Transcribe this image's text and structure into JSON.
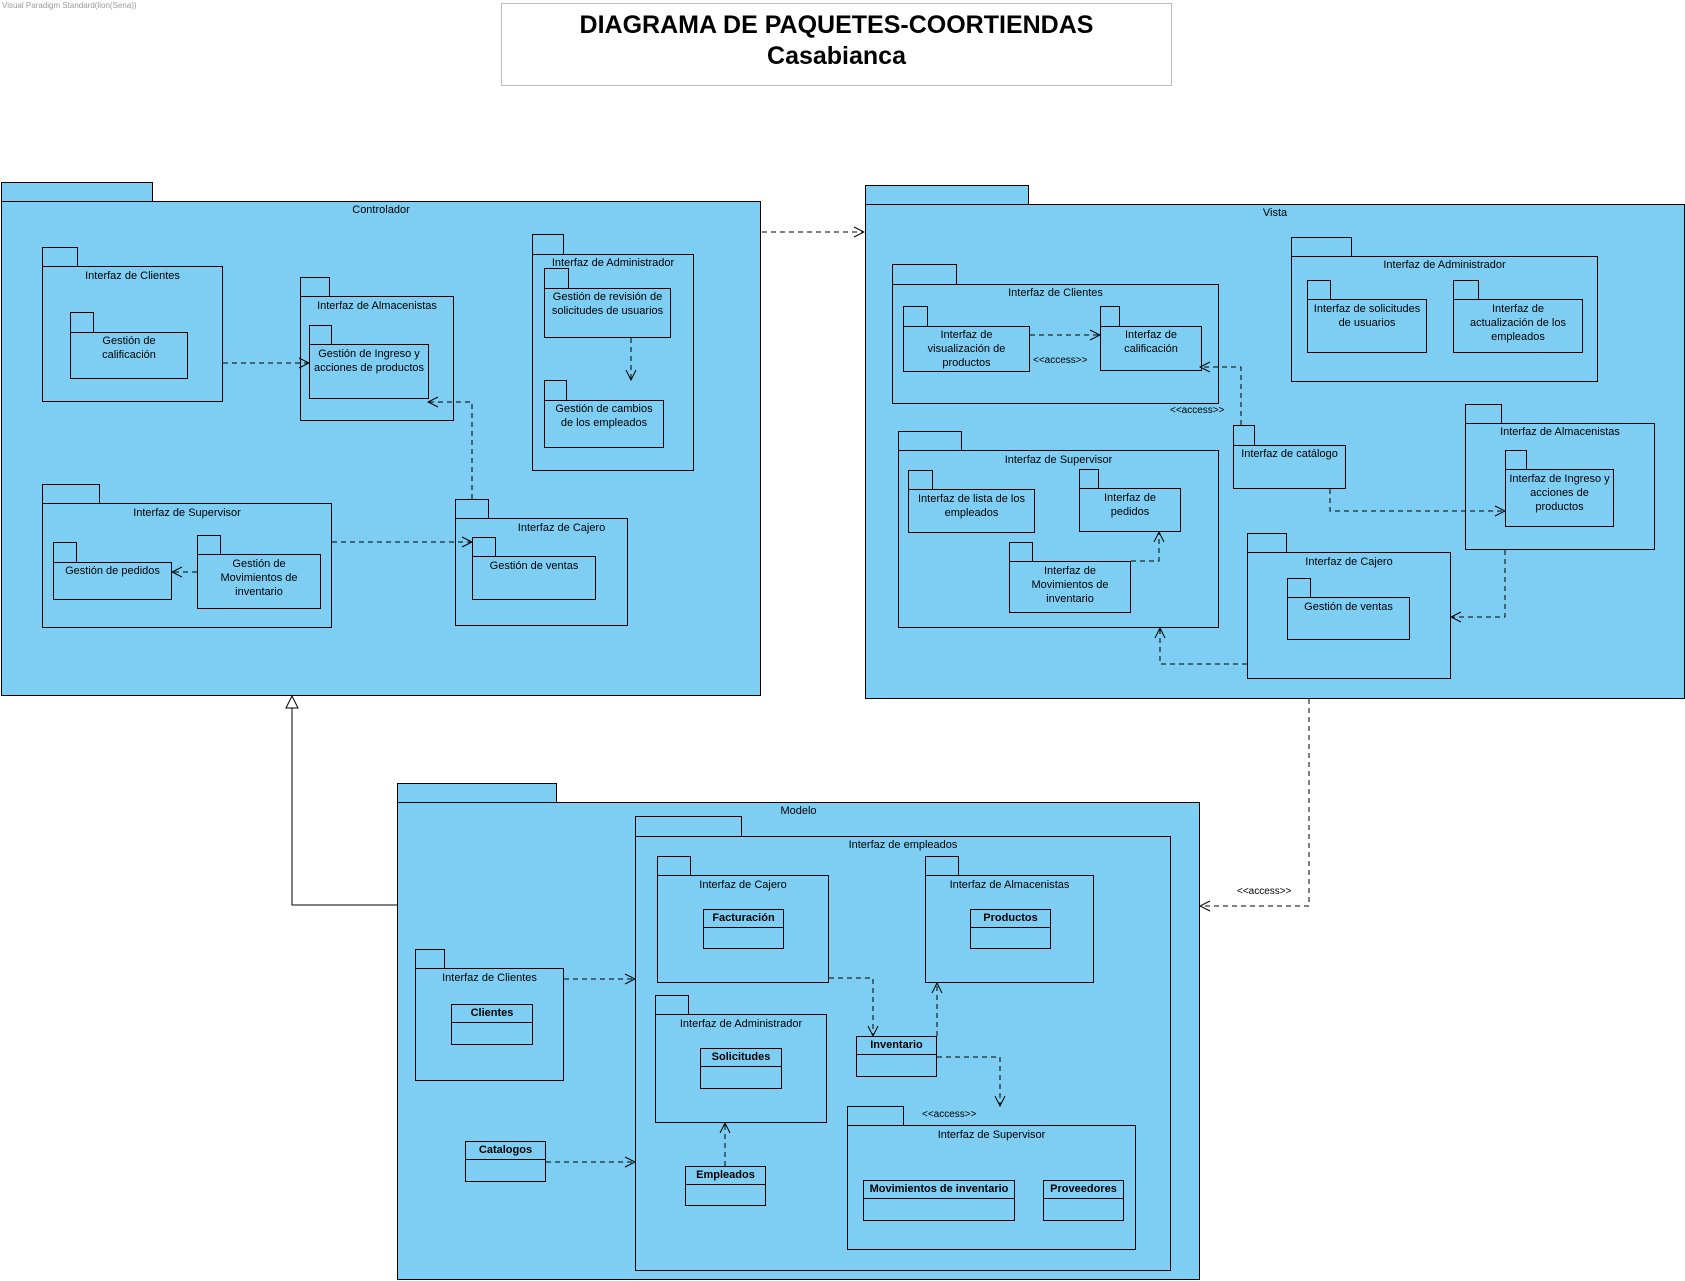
{
  "watermark": "Visual Paradigm Standard(lion(Sena))",
  "title": {
    "line1": "DIAGRAMA DE PAQUETES-COORTIENDAS",
    "line2": "Casabianca"
  },
  "packages": {
    "controlador": {
      "name": "Controlador",
      "clientes": {
        "name": "Interfaz de Clientes",
        "calificacion": "Gestión de calificación"
      },
      "almacenistas": {
        "name": "Interfaz de Almacenistas",
        "ingreso": "Gestión de Ingreso y acciones de productos"
      },
      "administrador": {
        "name": "Interfaz de Administrador",
        "revision": "Gestión de revisión de solicitudes de usuarios",
        "cambios": "Gestión de cambios de los empleados"
      },
      "supervisor": {
        "name": "Interfaz de Supervisor",
        "pedidos": "Gestión de pedidos",
        "movimientos": "Gestión de Movimientos de inventario"
      },
      "cajero": {
        "name": "Interfaz de Cajero",
        "ventas": "Gestión de ventas"
      }
    },
    "vista": {
      "name": "Vista",
      "clientes": {
        "name": "Interfaz de Clientes",
        "visualizacion": "Interfaz de visualización de productos",
        "calificacion": "Interfaz de calificación"
      },
      "administrador": {
        "name": "Interfaz de Administrador",
        "solicitudes": "Interfaz de solicitudes de usuarios",
        "actualizacion": "Interfaz de actualización de los empleados"
      },
      "supervisor": {
        "name": "Interfaz de Supervisor",
        "lista": "Interfaz de lista de los empleados",
        "pedidos": "Interfaz de pedidos",
        "movimientos": "Interfaz de Movimientos de inventario"
      },
      "catalogo": "Interfaz de catálogo",
      "almacenistas": {
        "name": "Interfaz de Almacenistas",
        "ingreso": "Interfaz de Ingreso y acciones de productos"
      },
      "cajero": {
        "name": "Interfaz de Cajero",
        "ventas": "Gestión de ventas"
      }
    },
    "modelo": {
      "name": "Modelo",
      "empleados": {
        "name": "Interfaz de empleados",
        "cajero": {
          "name": "Interfaz de Cajero",
          "cls": "Facturación"
        },
        "almacenistas": {
          "name": "Interfaz de Almacenistas",
          "cls": "Productos"
        },
        "administrador": {
          "name": "Interfaz de Administrador",
          "cls": "Solicitudes"
        },
        "inventario": "Inventario",
        "empleados_cls": "Empleados",
        "supervisor": {
          "name": "Interfaz de Supervisor",
          "movimientos": "Movimientos de inventario",
          "proveedores": "Proveedores"
        }
      },
      "clientes": {
        "name": "Interfaz de Clientes",
        "cls": "Clientes"
      },
      "catalogos": "Catalogos"
    }
  },
  "stereotypes": {
    "access": "<<access>>"
  },
  "colors": {
    "package_fill": "#7ecef4",
    "line": "#000000",
    "background": "#ffffff"
  }
}
